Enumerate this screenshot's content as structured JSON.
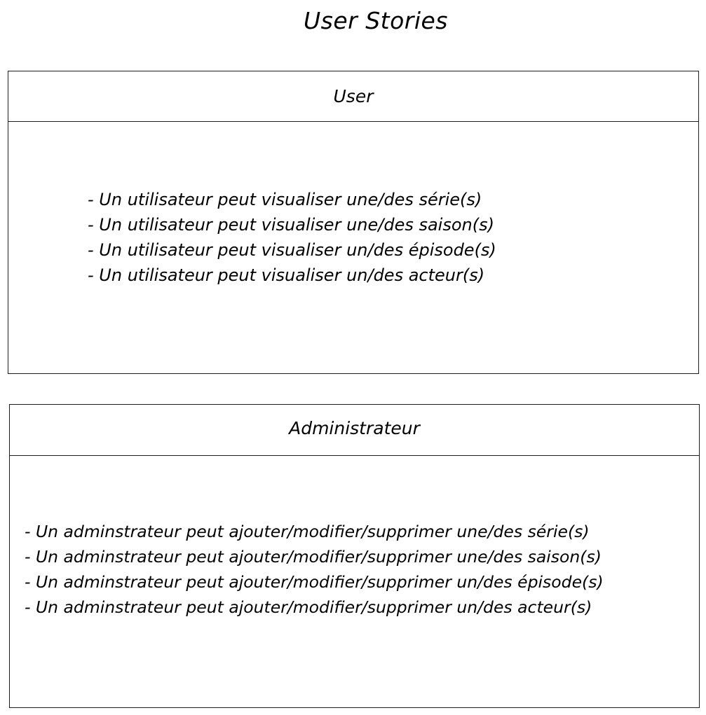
{
  "title": "User Stories",
  "panels": [
    {
      "header": "User",
      "items": [
        "Un utilisateur peut visualiser une/des série(s)",
        "Un utilisateur peut visualiser une/des saison(s)",
        "Un utilisateur peut visualiser un/des épisode(s)",
        "Un utilisateur peut visualiser un/des acteur(s)"
      ]
    },
    {
      "header": "Administrateur",
      "items": [
        "Un adminstrateur peut ajouter/modifier/supprimer une/des série(s)",
        "Un adminstrateur peut ajouter/modifier/supprimer une/des saison(s)",
        "Un adminstrateur peut ajouter/modifier/supprimer un/des épisode(s)",
        "Un adminstrateur peut ajouter/modifier/supprimer un/des acteur(s)"
      ]
    }
  ]
}
